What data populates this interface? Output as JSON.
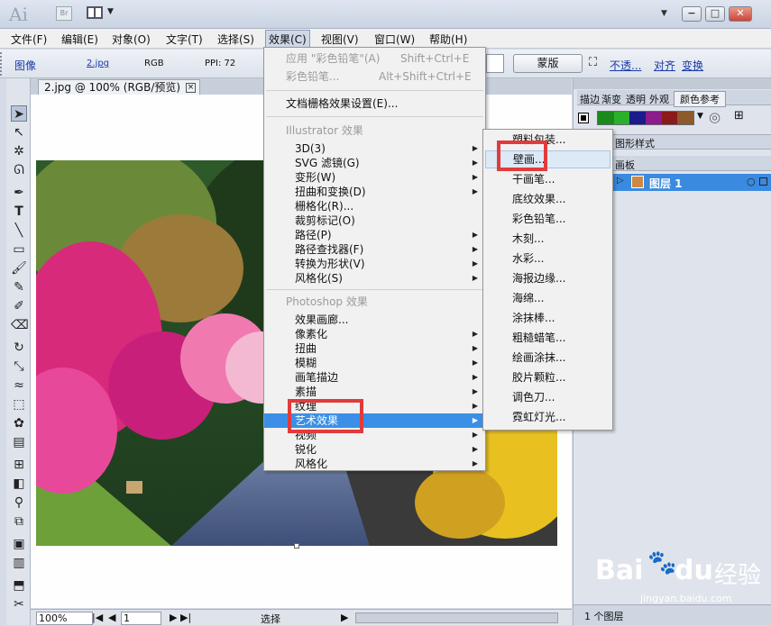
{
  "window": {
    "app_logo": "Ai",
    "bridge_label": "Br",
    "btn_minimize": "−",
    "btn_restore": "□",
    "btn_close": "✕"
  },
  "menubar": {
    "items": [
      "文件(F)",
      "编辑(E)",
      "对象(O)",
      "文字(T)",
      "选择(S)",
      "效果(C)",
      "视图(V)",
      "窗口(W)",
      "帮助(H)"
    ]
  },
  "controlbar": {
    "type": "图像",
    "file": "2.jpg",
    "mode": "RGB",
    "ppi": "PPI: 72",
    "mask_button": "蒙版",
    "opacity_link": "不透...",
    "align_link": "对齐",
    "transform_link": "变换"
  },
  "document": {
    "tab_title": "2.jpg @ 100% (RGB/预览)",
    "tab_close": "×"
  },
  "statusbar": {
    "zoom": "100%",
    "page": "1",
    "tool": "选择"
  },
  "effect_menu": {
    "apply_label": "应用 \"彩色铅笔\"(A)",
    "apply_shortcut": "Shift+Ctrl+E",
    "last_label": "彩色铅笔...",
    "last_shortcut": "Alt+Shift+Ctrl+E",
    "raster_settings": "文档栅格效果设置(E)...",
    "illustrator_header": "Illustrator 效果",
    "illustrator_items": [
      "3D(3)",
      "SVG 滤镜(G)",
      "变形(W)",
      "扭曲和变换(D)",
      "栅格化(R)...",
      "裁剪标记(O)",
      "路径(P)",
      "路径查找器(F)",
      "转换为形状(V)",
      "风格化(S)"
    ],
    "photoshop_header": "Photoshop 效果",
    "photoshop_items": [
      "效果画廊...",
      "像素化",
      "扭曲",
      "模糊",
      "画笔描边",
      "素描",
      "纹理",
      "艺术效果",
      "视频",
      "锐化",
      "风格化"
    ]
  },
  "artistic_submenu": {
    "items": [
      "塑料包装...",
      "壁画...",
      "干画笔...",
      "底纹效果...",
      "彩色铅笔...",
      "木刻...",
      "水彩...",
      "海报边缘...",
      "海绵...",
      "涂抹棒...",
      "粗糙蜡笔...",
      "绘画涂抹...",
      "胶片颗粒...",
      "调色刀...",
      "霓虹灯光..."
    ]
  },
  "panels": {
    "tabs_top": [
      "描边",
      "渐变",
      "透明",
      "外观",
      "颜色参考"
    ],
    "graphic_styles": "图形样式",
    "layers_tab": "画板",
    "layer_name": "图层 1",
    "layer_count": "1 个图层"
  },
  "swatches": [
    "#1a8a1a",
    "#2bb02b",
    "#1b1b8c",
    "#8c1b8c",
    "#8b1a1a",
    "#8c5a2b"
  ],
  "watermark": {
    "brand": "Bai",
    "brand2": "du",
    "cn": "经验",
    "url": "jingyan.baidu.com"
  }
}
